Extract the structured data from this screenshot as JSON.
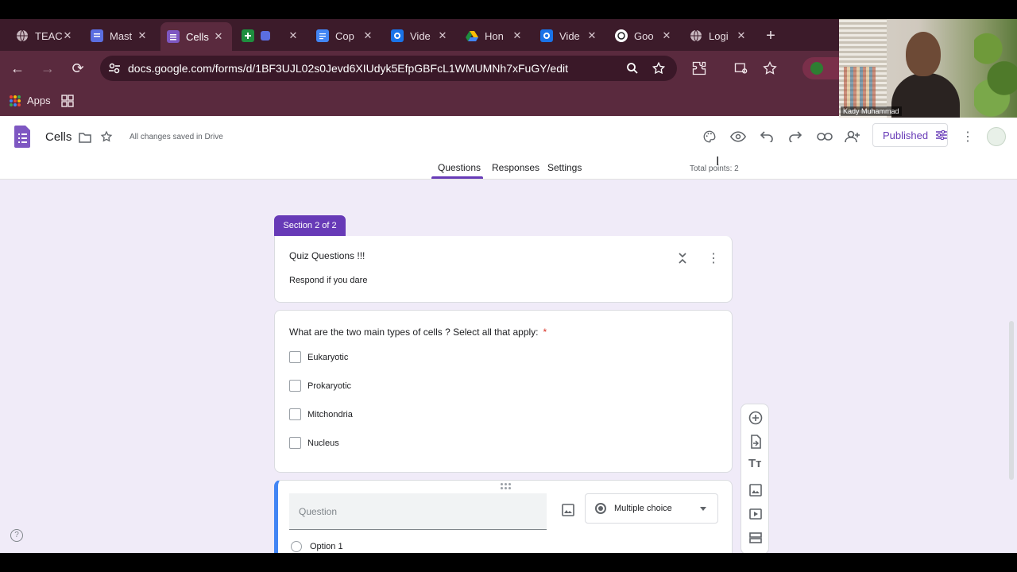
{
  "browser": {
    "tabs": [
      {
        "title": "TEAC",
        "fav": "globe-icon",
        "color": "#c9b8c0"
      },
      {
        "title": "Mast",
        "fav": "forms-icon",
        "color": "#5b6ee1"
      },
      {
        "title": "Cells",
        "fav": "forms-icon",
        "color": "#7e57c2",
        "active": true
      },
      {
        "title": "",
        "fav": "sheets-icon",
        "color": "#1e8e3e"
      },
      {
        "title": "Cop",
        "fav": "docs-icon",
        "color": "#4285f4"
      },
      {
        "title": "Vide",
        "fav": "gear-icon",
        "color": "#1a73e8"
      },
      {
        "title": "Hon",
        "fav": "drive-icon",
        "color": "#fbbc04"
      },
      {
        "title": "Vide",
        "fav": "gear-icon",
        "color": "#1a73e8"
      },
      {
        "title": "Goo",
        "fav": "openai-icon",
        "color": "#ffffff"
      },
      {
        "title": "Logi",
        "fav": "globe-icon",
        "color": "#c9b8c0"
      }
    ],
    "url": "docs.google.com/forms/d/1BF3UJL02s0Jevd6XIUdyk5EfpGBFcL1WMUMNh7xFuGY/edit",
    "bookmarks_apps": "Apps"
  },
  "header": {
    "doc_name": "Cells",
    "saved_status": "All changes saved in Drive",
    "publish_label": "Published",
    "tabs": [
      "Questions",
      "Responses",
      "Settings"
    ],
    "total_points": "Total points: 2"
  },
  "section": {
    "badge": "Section 2 of 2",
    "title": "Quiz Questions !!!",
    "description": "Respond if you dare"
  },
  "question": {
    "text": "What are the two main types of cells ? Select all that apply:",
    "required_mark": "*",
    "options": [
      "Eukaryotic",
      "Prokaryotic",
      "Mitchondria",
      "Nucleus"
    ]
  },
  "new_question": {
    "placeholder": "Question",
    "type": "Multiple choice",
    "option1": "Option 1"
  },
  "webcam": {
    "name": "Kady Muhammad"
  },
  "colors": {
    "accent": "#673ab7",
    "required": "#d93025",
    "focus": "#4285f4"
  }
}
